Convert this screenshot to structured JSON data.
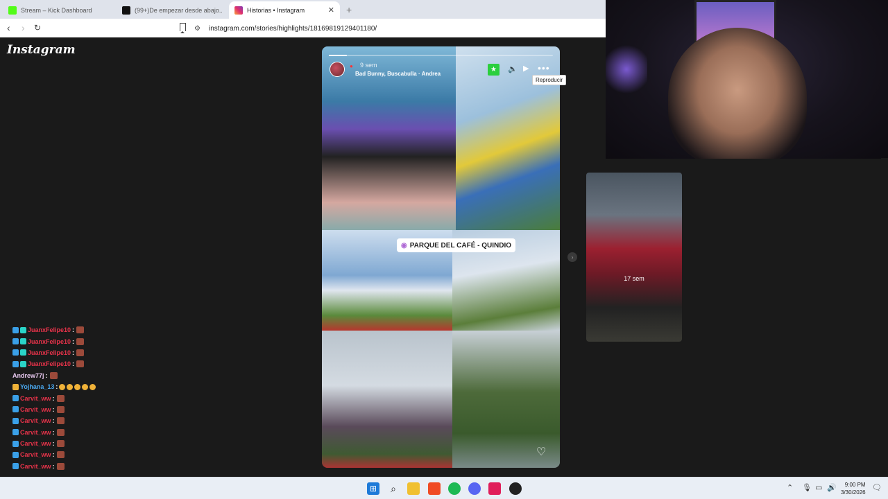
{
  "browser": {
    "tabs": [
      {
        "label": "Stream – Kick Dashboard",
        "favicon_color": "#53fc18"
      },
      {
        "label": "(99+)De empezar desde abajo... a pe",
        "favicon_color": "#111111"
      },
      {
        "label": "Historias • Instagram",
        "favicon_color": "#e1306c",
        "active": true
      }
    ],
    "url": "instagram.com/stories/highlights/18169819129401180/"
  },
  "instagram": {
    "logo": "Instagram",
    "story": {
      "progress": 0.08,
      "time": "9 sem",
      "music": "Bad Bunny, Buscabulla · Andrea",
      "tooltip": "Reproducir",
      "location_sticker": "PARQUE DEL CAFÉ - QUINDIO"
    },
    "side_story": {
      "time": "17 sem"
    }
  },
  "chat": [
    {
      "user": "JuanxFelipe10",
      "color": "#e8334a",
      "badges": [
        "#3aa0e8",
        "#2ad4c8"
      ],
      "emotes": 1
    },
    {
      "user": "JuanxFelipe10",
      "color": "#e8334a",
      "badges": [
        "#3aa0e8",
        "#2ad4c8"
      ],
      "emotes": 1
    },
    {
      "user": "JuanxFelipe10",
      "color": "#e8334a",
      "badges": [
        "#3aa0e8",
        "#2ad4c8"
      ],
      "emotes": 1
    },
    {
      "user": "JuanxFelipe10",
      "color": "#e8334a",
      "badges": [
        "#3aa0e8",
        "#2ad4c8"
      ],
      "emotes": 1
    },
    {
      "user": "Andrew77j",
      "color": "#e8c9f0",
      "badges": [],
      "emotes": 1
    },
    {
      "user": "Yojhana_13",
      "color": "#4aa8f0",
      "badges": [
        "#f0b238"
      ],
      "emotes": 5,
      "round": true
    },
    {
      "user": "Carvit_ww",
      "color": "#e8334a",
      "badges": [
        "#3aa0e8"
      ],
      "emotes": 1
    },
    {
      "user": "Carvit_ww",
      "color": "#e8334a",
      "badges": [
        "#3aa0e8"
      ],
      "emotes": 1
    },
    {
      "user": "Carvit_ww",
      "color": "#e8334a",
      "badges": [
        "#3aa0e8"
      ],
      "emotes": 1
    },
    {
      "user": "Carvit_ww",
      "color": "#e8334a",
      "badges": [
        "#3aa0e8"
      ],
      "emotes": 1
    },
    {
      "user": "Carvit_ww",
      "color": "#e8334a",
      "badges": [
        "#3aa0e8"
      ],
      "emotes": 1
    },
    {
      "user": "Carvit_ww",
      "color": "#e8334a",
      "badges": [
        "#3aa0e8"
      ],
      "emotes": 1
    },
    {
      "user": "Carvit_ww",
      "color": "#e8334a",
      "badges": [
        "#3aa0e8"
      ],
      "emotes": 1
    }
  ],
  "taskbar": {
    "time": "9:00 PM",
    "date": "3/30/2026",
    "icons": [
      "windows-start-icon",
      "search-icon",
      "file-explorer-icon",
      "brave-browser-icon",
      "spotify-icon",
      "discord-icon",
      "tiktok-icon",
      "obs-icon"
    ]
  }
}
